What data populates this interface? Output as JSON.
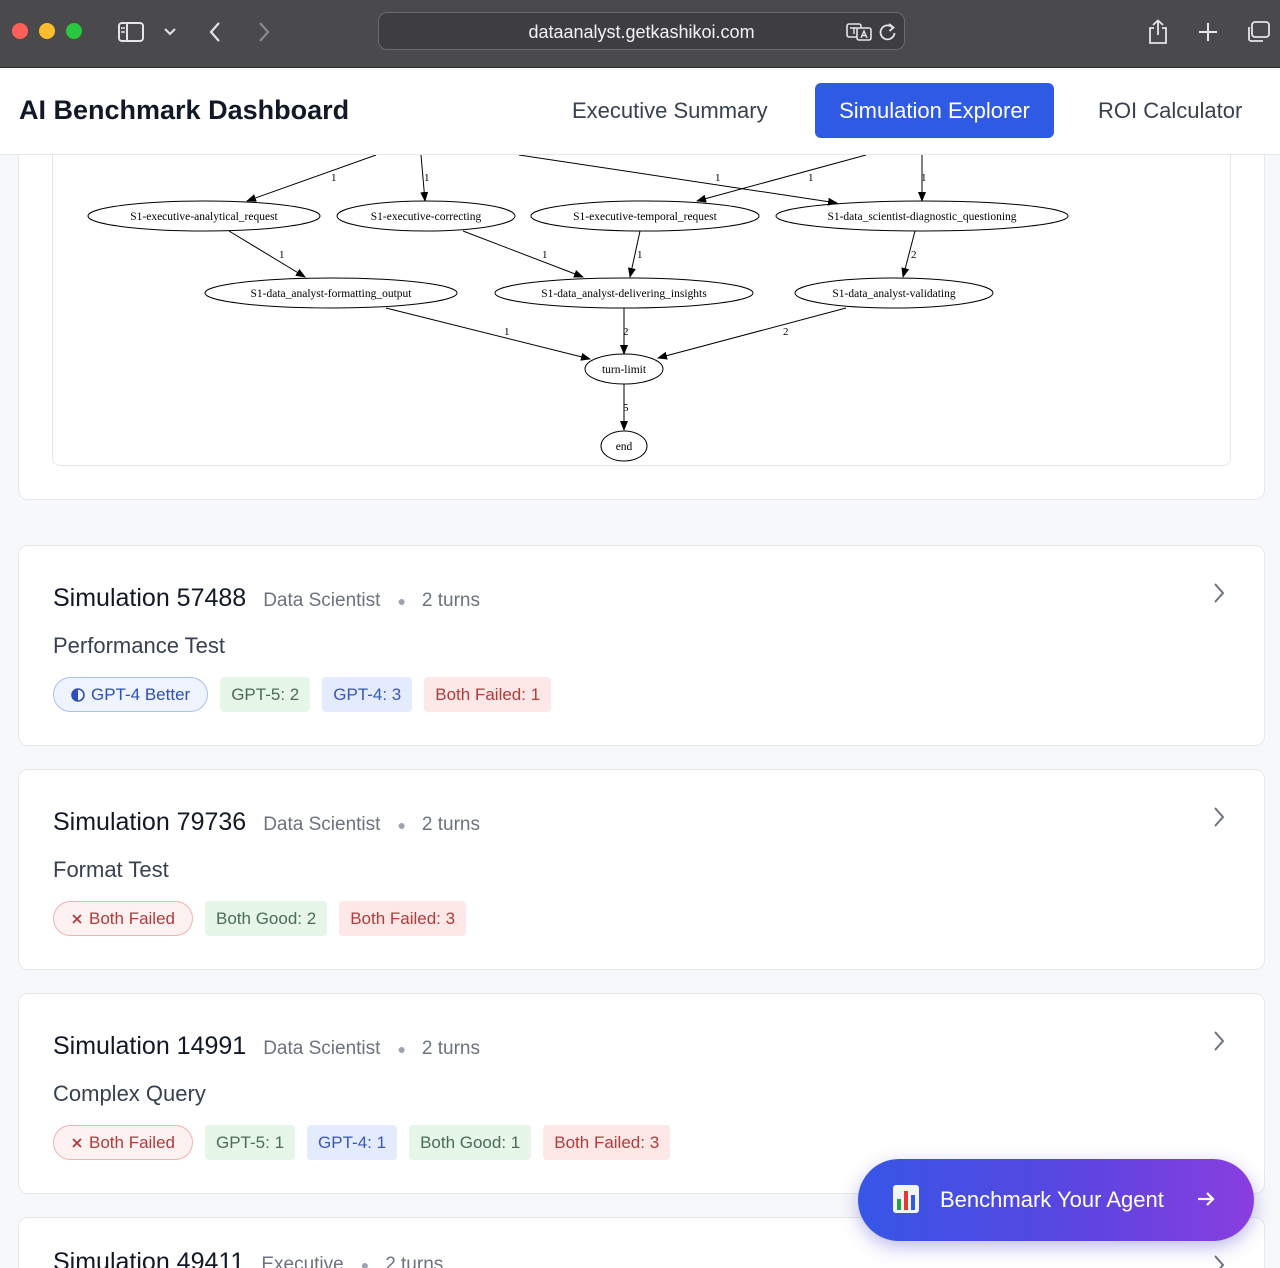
{
  "browser": {
    "url": "dataanalyst.getkashikoi.com"
  },
  "app": {
    "title": "AI Benchmark Dashboard",
    "tabs": [
      {
        "label": "Executive Summary",
        "active": false
      },
      {
        "label": "Simulation Explorer",
        "active": true
      },
      {
        "label": "ROI Calculator",
        "active": false
      }
    ]
  },
  "flow_graph": {
    "nodes": {
      "n1": "S1-executive-analytical_request",
      "n2": "S1-executive-correcting",
      "n3": "S1-executive-temporal_request",
      "n4": "S1-data_scientist-diagnostic_questioning",
      "n5": "S1-data_analyst-formatting_output",
      "n6": "S1-data_analyst-delivering_insights",
      "n7": "S1-data_analyst-validating",
      "n8": "turn-limit",
      "n9": "end"
    },
    "edges": [
      {
        "label": "1"
      },
      {
        "label": "1"
      },
      {
        "label": "1"
      },
      {
        "label": "1"
      },
      {
        "label": "1"
      },
      {
        "label": "1"
      },
      {
        "label": "1"
      },
      {
        "label": "1"
      },
      {
        "label": "2"
      },
      {
        "label": "1"
      },
      {
        "label": "2"
      },
      {
        "label": "2"
      },
      {
        "label": "5"
      }
    ]
  },
  "simulations": [
    {
      "title": "Simulation 57488",
      "role": "Data Scientist",
      "turns": "2 turns",
      "test": "Performance Test",
      "verdict": "GPT-4 Better",
      "verdict_icon": "half-circle-icon",
      "badges": [
        {
          "label": "GPT-5: 2",
          "kind": "gpt5"
        },
        {
          "label": "GPT-4: 3",
          "kind": "gpt4"
        },
        {
          "label": "Both Failed: 1",
          "kind": "fail"
        }
      ]
    },
    {
      "title": "Simulation 79736",
      "role": "Data Scientist",
      "turns": "2 turns",
      "test": "Format Test",
      "verdict": "Both Failed",
      "verdict_icon": "x-icon",
      "badges": [
        {
          "label": "Both Good: 2",
          "kind": "good"
        },
        {
          "label": "Both Failed: 3",
          "kind": "fail"
        }
      ]
    },
    {
      "title": "Simulation 14991",
      "role": "Data Scientist",
      "turns": "2 turns",
      "test": "Complex Query",
      "verdict": "Both Failed",
      "verdict_icon": "x-icon",
      "badges": [
        {
          "label": "GPT-5: 1",
          "kind": "gpt5"
        },
        {
          "label": "GPT-4: 1",
          "kind": "gpt4"
        },
        {
          "label": "Both Good: 1",
          "kind": "good"
        },
        {
          "label": "Both Failed: 3",
          "kind": "fail"
        }
      ]
    },
    {
      "title": "Simulation 49411",
      "role": "Executive",
      "turns": "2 turns"
    }
  ],
  "cta": {
    "label": "Benchmark Your Agent",
    "icon": "bar-chart-icon"
  },
  "colors": {
    "accent": "#2f5be4",
    "cta_gradient_start": "#3656e6",
    "cta_gradient_end": "#8a3ee0",
    "good_bg": "#e6f7ea",
    "gpt4_bg": "#e3ebfd",
    "fail_bg": "#fde7e7"
  }
}
